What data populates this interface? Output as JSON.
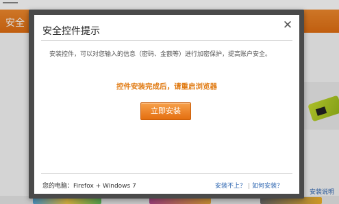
{
  "background": {
    "nav_label": "安全",
    "sidebar_text": "全",
    "right_links": "安装说明"
  },
  "dialog": {
    "title": "安全控件提示",
    "close_glyph": "✕",
    "description": "安装控件，可以对您输入的信息（密码、金额等）进行加密保护，提高账户安全。",
    "notice": "控件安装完成后，请重启浏览器",
    "install_button": "立即安装",
    "footer": {
      "environment": "您的电脑：Firefox + Windows 7",
      "link_install_failed": "安装不上？",
      "separator": "|",
      "link_how_to_install": "如何安装？"
    }
  },
  "colors": {
    "nav_orange": "#e8761a",
    "notice_orange": "#e07a12",
    "button_orange": "#ee8a2c",
    "link_blue": "#2b64b0",
    "frame_dark": "#4a4a4a"
  },
  "icons": {
    "close": "close-icon"
  }
}
